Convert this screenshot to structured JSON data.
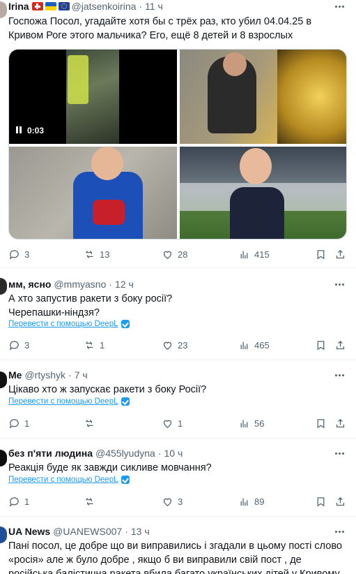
{
  "posts": [
    {
      "name": "Irina",
      "handle": "@jatsenkoirina",
      "time": "11 ч",
      "text": "Госпожа Посол, угадайте хотя бы с трёх раз, кто убил 04.04.25 в Кривом Роге этого мальчика? Его, ещё 8 детей и 8 взрослых",
      "video_time": "0:03",
      "replies": "3",
      "reposts": "13",
      "likes": "28",
      "views": "415"
    },
    {
      "name": "мм, ясно",
      "handle": "@mmyasno",
      "time": "12 ч",
      "text": "А хто запустив ракети з боку росії?\nЧерепашки-ніндзя?",
      "translate": "Перевести с помощью DeepL",
      "replies": "3",
      "reposts": "1",
      "likes": "23",
      "views": "465"
    },
    {
      "name": "Me",
      "handle": "@rtyshyk",
      "time": "7 ч",
      "text": "Цікаво хто ж запускає ракети з боку Росії?",
      "translate": "Перевести с помощью DeepL",
      "replies": "1",
      "reposts": "",
      "likes": "1",
      "views": "56"
    },
    {
      "name": "без п'яти людина",
      "handle": "@455lyudyna",
      "time": "10 ч",
      "text": "Реакція буде як завжди сикливе мовчання?",
      "translate": "Перевести с помощью DeepL",
      "replies": "1",
      "reposts": "",
      "likes": "3",
      "views": "89"
    },
    {
      "name": "UA News",
      "handle": "@UANEWS007",
      "time": "13 ч",
      "text": "Пані посол, це добре що ви виправились і згадали в цьому пості слово «росія» але ж було добре , якщо б ви виправили свій пост , де російська балістична ракета вбила багато українських дітей у Кривому Розі."
    }
  ],
  "colors": {
    "text": "#0f1419",
    "secondary": "#536471",
    "link": "#1d9bf0",
    "divider": "#eff3f4"
  },
  "icons": [
    "reply-icon",
    "repost-icon",
    "like-icon",
    "views-icon",
    "bookmark-icon",
    "share-icon",
    "more-icon",
    "pause-icon",
    "translate-badge-icon"
  ]
}
